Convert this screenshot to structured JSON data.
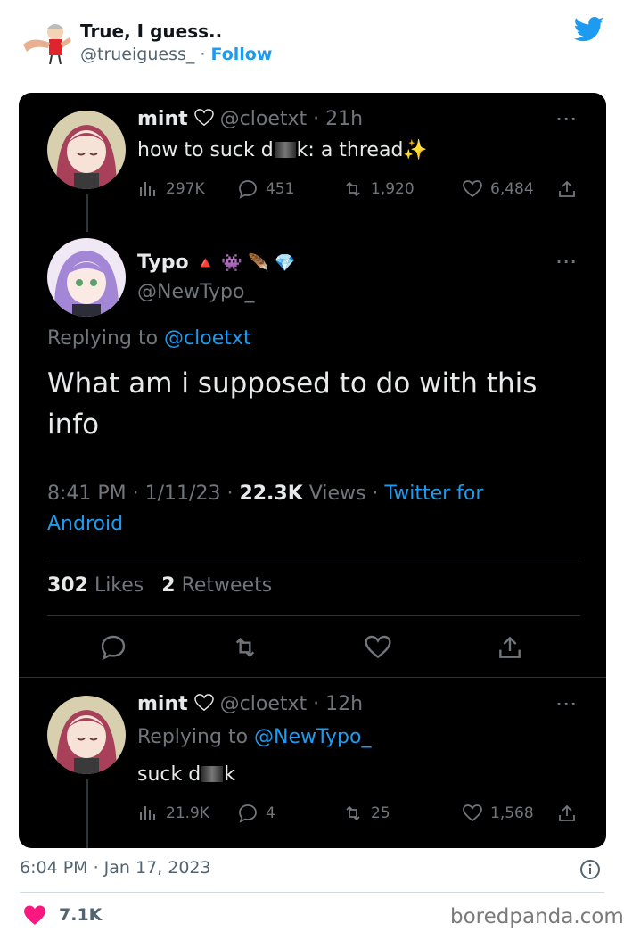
{
  "embed": {
    "display_name": "True, I guess..",
    "handle": "@trueiguess_",
    "separator": " · ",
    "follow_label": "Follow",
    "timestamp": "6:04 PM · Jan 17, 2023",
    "like_count": "7.1K"
  },
  "original_tweet": {
    "display_name": "mint",
    "handle": "@cloetxt",
    "time": "21h",
    "text_before": "how to suck d",
    "text_after": "k: a thread",
    "emoji": "✨",
    "views": "297K",
    "replies": "451",
    "retweets": "1,920",
    "likes": "6,484"
  },
  "main_tweet": {
    "display_name": "Typo",
    "badges": "🔺 👾 🪶 💎",
    "handle": "@NewTypo_",
    "replying_label": "Replying to",
    "replying_handle": "@cloetxt",
    "text": "What am i supposed to do with this info",
    "time": "8:41 PM",
    "date": "1/11/23",
    "views": "22.3K",
    "views_label": "Views",
    "client_line1": "Twitter for",
    "client_line2": "Android",
    "likes_count": "302",
    "likes_label": "Likes",
    "retweets_count": "2",
    "retweets_label": "Retweets"
  },
  "reply_tweet": {
    "display_name": "mint",
    "handle": "@cloetxt",
    "time": "12h",
    "replying_label": "Replying to",
    "replying_handle": "@NewTypo_",
    "text_before": "suck d",
    "text_after": "k",
    "views": "21.9K",
    "replies": "4",
    "retweets": "25",
    "likes": "1,568"
  },
  "watermark": "boredpanda.com",
  "colors": {
    "link_blue": "#1d9bf0",
    "like_pink": "#f91880",
    "card_bg": "#000000"
  }
}
